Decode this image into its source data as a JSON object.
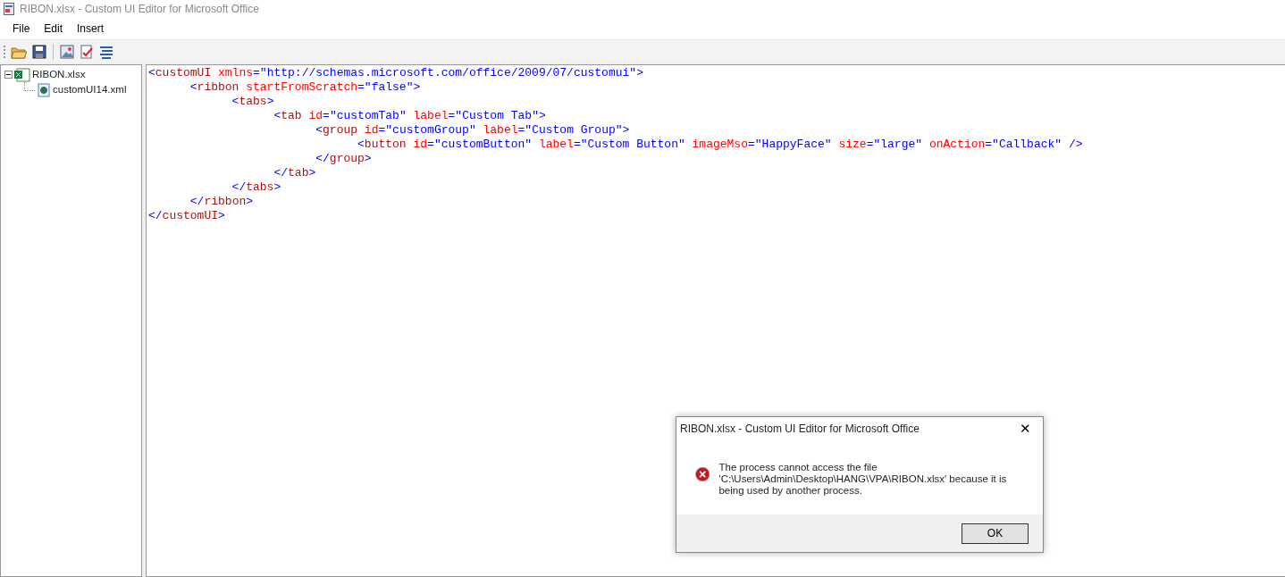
{
  "window": {
    "title": "RIBON.xlsx - Custom UI Editor for Microsoft Office"
  },
  "menu": [
    "File",
    "Edit",
    "Insert"
  ],
  "tree": [
    {
      "label": "RIBON.xlsx",
      "expanded": true,
      "kind": "workbook",
      "children": [
        {
          "label": "customUI14.xml",
          "kind": "xml"
        }
      ]
    }
  ],
  "editor": {
    "lines": [
      [
        {
          "kind": "punct",
          "text": "<"
        },
        {
          "kind": "tag",
          "text": "customUI "
        },
        {
          "kind": "attr",
          "text": "xmlns"
        },
        {
          "kind": "punct",
          "text": "="
        },
        {
          "kind": "value",
          "text": "\"http://schemas.microsoft.com/office/2009/07/customui\""
        },
        {
          "kind": "punct",
          "text": ">"
        }
      ],
      [
        {
          "kind": "punct",
          "text": "      <"
        },
        {
          "kind": "tag",
          "text": "ribbon "
        },
        {
          "kind": "attr",
          "text": "startFromScratch"
        },
        {
          "kind": "punct",
          "text": "="
        },
        {
          "kind": "value",
          "text": "\"false\""
        },
        {
          "kind": "punct",
          "text": ">"
        }
      ],
      [
        {
          "kind": "punct",
          "text": "            <"
        },
        {
          "kind": "tag",
          "text": "tabs"
        },
        {
          "kind": "punct",
          "text": ">"
        }
      ],
      [
        {
          "kind": "punct",
          "text": "                  <"
        },
        {
          "kind": "tag",
          "text": "tab "
        },
        {
          "kind": "attr",
          "text": "id"
        },
        {
          "kind": "punct",
          "text": "="
        },
        {
          "kind": "value",
          "text": "\"customTab\" "
        },
        {
          "kind": "attr",
          "text": "label"
        },
        {
          "kind": "punct",
          "text": "="
        },
        {
          "kind": "value",
          "text": "\"Custom Tab\""
        },
        {
          "kind": "punct",
          "text": ">"
        }
      ],
      [
        {
          "kind": "punct",
          "text": "                        <"
        },
        {
          "kind": "tag",
          "text": "group "
        },
        {
          "kind": "attr",
          "text": "id"
        },
        {
          "kind": "punct",
          "text": "="
        },
        {
          "kind": "value",
          "text": "\"customGroup\" "
        },
        {
          "kind": "attr",
          "text": "label"
        },
        {
          "kind": "punct",
          "text": "="
        },
        {
          "kind": "value",
          "text": "\"Custom Group\""
        },
        {
          "kind": "punct",
          "text": ">"
        }
      ],
      [
        {
          "kind": "punct",
          "text": "                              <"
        },
        {
          "kind": "tag",
          "text": "button "
        },
        {
          "kind": "attr",
          "text": "id"
        },
        {
          "kind": "punct",
          "text": "="
        },
        {
          "kind": "value",
          "text": "\"customButton\" "
        },
        {
          "kind": "attr",
          "text": "label"
        },
        {
          "kind": "punct",
          "text": "="
        },
        {
          "kind": "value",
          "text": "\"Custom Button\" "
        },
        {
          "kind": "attr",
          "text": "imageMso"
        },
        {
          "kind": "punct",
          "text": "="
        },
        {
          "kind": "value",
          "text": "\"HappyFace\" "
        },
        {
          "kind": "attr",
          "text": "size"
        },
        {
          "kind": "punct",
          "text": "="
        },
        {
          "kind": "value",
          "text": "\"large\" "
        },
        {
          "kind": "attr",
          "text": "onAction"
        },
        {
          "kind": "punct",
          "text": "="
        },
        {
          "kind": "value",
          "text": "\"Callback\" "
        },
        {
          "kind": "punct",
          "text": "/>"
        }
      ],
      [
        {
          "kind": "punct",
          "text": "                        </"
        },
        {
          "kind": "tag",
          "text": "group"
        },
        {
          "kind": "punct",
          "text": ">"
        }
      ],
      [
        {
          "kind": "punct",
          "text": "                  </"
        },
        {
          "kind": "tag",
          "text": "tab"
        },
        {
          "kind": "punct",
          "text": ">"
        }
      ],
      [
        {
          "kind": "punct",
          "text": "            </"
        },
        {
          "kind": "tag",
          "text": "tabs"
        },
        {
          "kind": "punct",
          "text": ">"
        }
      ],
      [
        {
          "kind": "punct",
          "text": "      </"
        },
        {
          "kind": "tag",
          "text": "ribbon"
        },
        {
          "kind": "punct",
          "text": ">"
        }
      ],
      [
        {
          "kind": "punct",
          "text": "</"
        },
        {
          "kind": "tag",
          "text": "customUI"
        },
        {
          "kind": "punct",
          "text": ">"
        }
      ]
    ]
  },
  "dialog": {
    "title": "RIBON.xlsx - Custom UI Editor for Microsoft Office",
    "close": "✕",
    "message": "The process cannot access the file 'C:\\Users\\Admin\\Desktop\\HANG\\VPA\\RIBON.xlsx' because it is being used by another process.",
    "button": "OK"
  }
}
